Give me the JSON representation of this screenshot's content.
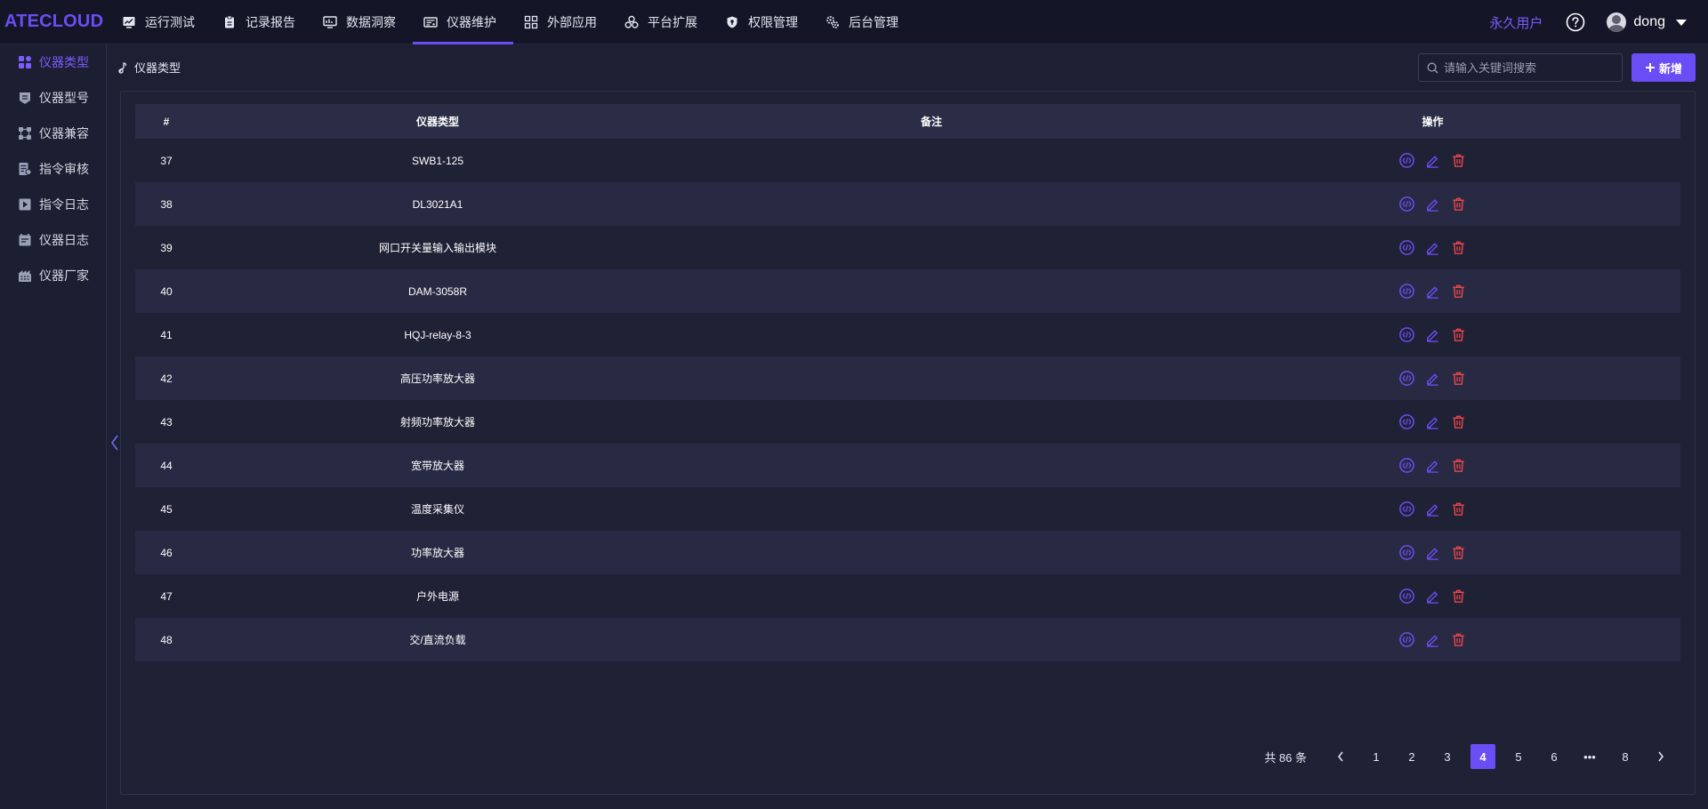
{
  "app": {
    "logo": "ATECLOUD"
  },
  "nav": [
    {
      "label": "运行测试",
      "icon": "chart-monitor-icon"
    },
    {
      "label": "记录报告",
      "icon": "clipboard-icon"
    },
    {
      "label": "数据洞察",
      "icon": "monitor-icon"
    },
    {
      "label": "仪器维护",
      "icon": "instrument-icon",
      "active": true
    },
    {
      "label": "外部应用",
      "icon": "grid-icon"
    },
    {
      "label": "平台扩展",
      "icon": "cluster-icon"
    },
    {
      "label": "权限管理",
      "icon": "shield-icon"
    },
    {
      "label": "后台管理",
      "icon": "gears-icon"
    }
  ],
  "user": {
    "perm_label": "永久用户",
    "name": "dong"
  },
  "sidebar": [
    {
      "label": "仪器类型",
      "active": true
    },
    {
      "label": "仪器型号"
    },
    {
      "label": "仪器兼容"
    },
    {
      "label": "指令审核"
    },
    {
      "label": "指令日志"
    },
    {
      "label": "仪器日志"
    },
    {
      "label": "仪器厂家"
    }
  ],
  "page": {
    "title": "仪器类型"
  },
  "search": {
    "placeholder": "请输入关键词搜索"
  },
  "add_button": {
    "label": "新增"
  },
  "table": {
    "headers": [
      "#",
      "仪器类型",
      "备注",
      "操作"
    ],
    "rows": [
      {
        "id": "37",
        "type": "SWB1-125",
        "note": ""
      },
      {
        "id": "38",
        "type": "DL3021A1",
        "note": ""
      },
      {
        "id": "39",
        "type": "网口开关量输入输出模块",
        "note": ""
      },
      {
        "id": "40",
        "type": "DAM-3058R",
        "note": ""
      },
      {
        "id": "41",
        "type": "HQJ-relay-8-3",
        "note": ""
      },
      {
        "id": "42",
        "type": "高压功率放大器",
        "note": ""
      },
      {
        "id": "43",
        "type": "射频功率放大器",
        "note": ""
      },
      {
        "id": "44",
        "type": "宽带放大器",
        "note": ""
      },
      {
        "id": "45",
        "type": "温度采集仪",
        "note": ""
      },
      {
        "id": "46",
        "type": "功率放大器",
        "note": ""
      },
      {
        "id": "47",
        "type": "户外电源",
        "note": ""
      },
      {
        "id": "48",
        "type": "交/直流负载",
        "note": ""
      }
    ]
  },
  "pagination": {
    "total_text": "共 86 条",
    "pages": [
      "1",
      "2",
      "3",
      "4",
      "5",
      "6",
      "•••",
      "8"
    ],
    "current": "4"
  },
  "colors": {
    "accent": "#6b4df5",
    "delete": "#e8454a",
    "background": "#1d1f33"
  }
}
